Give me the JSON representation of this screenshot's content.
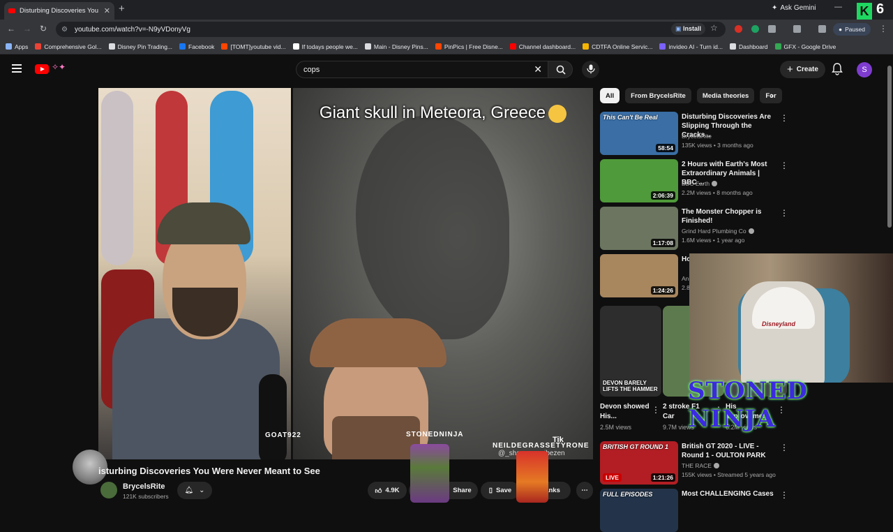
{
  "browser": {
    "tab_title": "Disturbing Discoveries You",
    "url": "youtube.com/watch?v=-N9yVDonyVg",
    "ask_gemini": "Ask Gemini",
    "install": "Install",
    "profile_status": "Paused",
    "overlay_letter": "K",
    "overlay_number": "6",
    "bookmarks": [
      {
        "label": "Apps",
        "color": "#8ab4f8"
      },
      {
        "label": "Comprehensive Gol...",
        "color": "#ea4335"
      },
      {
        "label": "Disney Pin Trading...",
        "color": "#dadce0"
      },
      {
        "label": "Facebook",
        "color": "#1877f2"
      },
      {
        "label": "[TOMT]youtube vid...",
        "color": "#ff4500"
      },
      {
        "label": "If todays people we...",
        "color": "#ffffff"
      },
      {
        "label": "Main - Disney Pins...",
        "color": "#dadce0"
      },
      {
        "label": "PinPics | Free Disne...",
        "color": "#ff4500"
      },
      {
        "label": "Channel dashboard...",
        "color": "#ff0000"
      },
      {
        "label": "CDTFA Online Servic...",
        "color": "#f4b400"
      },
      {
        "label": "invideo AI - Turn id...",
        "color": "#7b61ff"
      },
      {
        "label": "Dashboard",
        "color": "#dadce0"
      },
      {
        "label": "GFX - Google Drive",
        "color": "#34a853"
      }
    ]
  },
  "youtube": {
    "search_value": "cops",
    "create_label": "Create",
    "avatar_letter": "S"
  },
  "video": {
    "caption": "Giant skull in Meteora, Greece",
    "overlay_goat": "GOAT922",
    "overlay_stoned": "STONEDNINJA",
    "overlay_neil": "NEILDEGRASSETYRONE",
    "overlay_shay": "@_shay...en_vibezen",
    "overlay_tiktok": "Tik",
    "title": "isturbing Discoveries You Were Never Meant to See",
    "channel": "BrycelsRite",
    "subscribers": "121K subscribers",
    "likes": "4.9K",
    "share": "Share",
    "save": "Save",
    "thanks": "hanks"
  },
  "sidebar": {
    "chips": [
      "All",
      "From BrycelsRite",
      "Media theories",
      "For"
    ],
    "recs": [
      {
        "title": "Disturbing Discoveries Are Slipping Through the Cracks...",
        "channel": "BrycelsRite",
        "verified": false,
        "meta": "135K views • 3 months ago",
        "duration": "58:54",
        "thumb_text": "This Can't Be Real",
        "color": "#3a6ea5"
      },
      {
        "title": "2 Hours with Earth's Most Extraordinary Animals | BBC ...",
        "channel": "BBC Earth",
        "verified": true,
        "meta": "2.2M views • 8 months ago",
        "duration": "2:06:39",
        "thumb_text": "",
        "color": "#4f9a3a"
      },
      {
        "title": "The Monster Chopper is Finished!",
        "channel": "Grind Hard Plumbing Co",
        "verified": true,
        "meta": "1.6M views • 1 year ago",
        "duration": "1:17:08",
        "thumb_text": "",
        "color": "#6b7560"
      },
      {
        "title": "Ho Wo",
        "channel": "Ani",
        "verified": false,
        "meta": "2.8",
        "duration": "1:24:26",
        "thumb_text": "",
        "color": "#a8865e"
      }
    ],
    "shorts": [
      {
        "title": "Devon showed His...",
        "views": "2.5M views",
        "thumb_text": "DEVON BARELY LIFTS THE HAMMER",
        "color": "#2d2d2d"
      },
      {
        "title": "2 stroke F1 Car",
        "views": "9.7M views",
        "thumb_text": "",
        "color": "#5d7a4e"
      },
      {
        "title": "His Improveme...",
        "views": "6.2M views",
        "thumb_text": "",
        "color": "#444"
      }
    ],
    "recs2": [
      {
        "title": "British GT 2020 - LIVE - Round 1 - OULTON PARK",
        "channel": "THE RACE",
        "verified": true,
        "meta": "155K views • Streamed 5 years ago",
        "duration": "1:21:26",
        "thumb_text": "BRITISH GT ROUND 1",
        "live": "LIVE",
        "color": "#b21e24"
      },
      {
        "title": "Most CHALLENGING Cases",
        "channel": "",
        "verified": false,
        "meta": "",
        "duration": "",
        "thumb_text": "FULL EPISODES",
        "color": "#23344a"
      }
    ]
  },
  "overlay": {
    "hat_logo": "Disneyland",
    "stoned_banner": "STONED NINJA"
  }
}
